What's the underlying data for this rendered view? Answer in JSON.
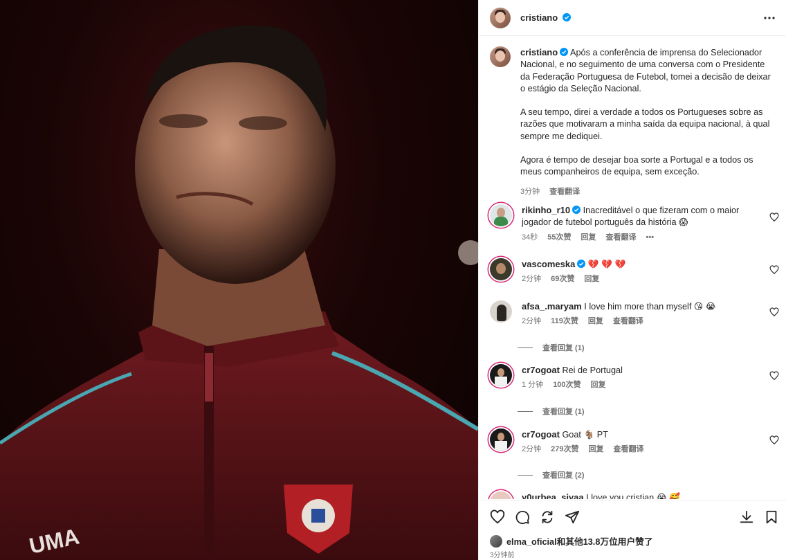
{
  "post": {
    "author": "cristiano",
    "caption_author": "cristiano",
    "caption_paragraphs": [
      "Após a conferência de imprensa do Selecionador Nacional, e no seguimento de uma conversa com o Presidente da Federação Portuguesa de Futebol, tomei a decisão de deixar o estágio da Seleção Nacional.",
      "A seu tempo, direi a verdade a todos os Portugueses sobre as razões que motivaram a minha saída da equipa nacional, à qual sempre me dediquei.",
      "Agora é tempo de desejar boa sorte a Portugal e a todos os meus companheiros de equipa, sem exceção."
    ],
    "caption_time": "3分钟",
    "translate_label": "查看翻译"
  },
  "comments": [
    {
      "user": "rikinho_r10",
      "text": "Inacreditável o que fizeram com o maior jogador de futebol português da história 😱",
      "time": "34秒",
      "likes": "55次赞",
      "reply": "回复",
      "translate": "查看翻译",
      "more": "•••"
    },
    {
      "user": "vascomeska",
      "text": "💔 💔 💔",
      "time": "2分钟",
      "likes": "69次赞",
      "reply": "回复"
    },
    {
      "user": "afsa_.maryam",
      "text": "I love him more than myself 😘 😭",
      "time": "2分钟",
      "likes": "119次赞",
      "reply": "回复",
      "translate": "查看翻译",
      "replies": "查看回复 (1)"
    },
    {
      "user": "cr7ogoat",
      "text": "Rei de Portugal",
      "time": "1 分钟",
      "likes": "100次赞",
      "reply": "回复",
      "replies": "查看回复 (1)"
    },
    {
      "user": "cr7ogoat",
      "text": "Goat 🐐 PT",
      "time": "2分钟",
      "likes": "279次赞",
      "reply": "回复",
      "translate": "查看翻译",
      "replies": "查看回复 (2)"
    },
    {
      "user": "y0urbea_siyaa",
      "text": "I love you cristian 😭 🥰"
    }
  ],
  "footer": {
    "likes_text": "elma_oficial和其他13.8万位用户赞了",
    "time": "3分钟前"
  },
  "colors": {
    "verified": "#0095f6",
    "muted": "#737373",
    "border": "#efefef"
  },
  "icons": [
    "more-icon",
    "heart-icon",
    "comment-icon",
    "share-icon",
    "send-icon",
    "download-icon",
    "bookmark-icon",
    "verified-icon"
  ]
}
